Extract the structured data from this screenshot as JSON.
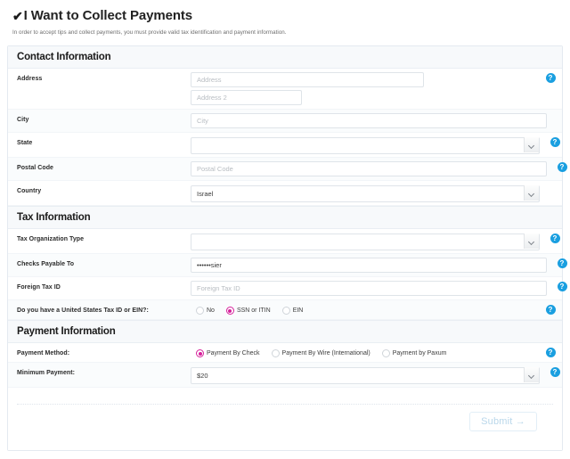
{
  "header": {
    "check_icon": "✔",
    "title": "I Want to Collect Payments",
    "subtitle": "In order to accept tips and collect payments, you must provide valid tax identification and payment information."
  },
  "help_icon_glyph": "?",
  "sections": {
    "contact": {
      "heading": "Contact Information",
      "address": {
        "label": "Address",
        "line1_placeholder": "Address",
        "line1_value": "",
        "line2_placeholder": "Address 2",
        "line2_value": ""
      },
      "city": {
        "label": "City",
        "placeholder": "City",
        "value": ""
      },
      "state": {
        "label": "State",
        "value": ""
      },
      "postal_code": {
        "label": "Postal Code",
        "placeholder": "Postal Code",
        "value": ""
      },
      "country": {
        "label": "Country",
        "value": "Israel"
      }
    },
    "tax": {
      "heading": "Tax Information",
      "org_type": {
        "label": "Tax Organization Type",
        "value": ""
      },
      "checks_payable_to": {
        "label": "Checks Payable To",
        "value": "••••••sier"
      },
      "foreign_tax_id": {
        "label": "Foreign Tax ID",
        "placeholder": "Foreign Tax ID",
        "value": ""
      },
      "us_tax_id": {
        "label": "Do you have a United States Tax ID or EIN?:",
        "options": [
          {
            "label": "No",
            "selected": false
          },
          {
            "label": "SSN or ITIN",
            "selected": true
          },
          {
            "label": "EIN",
            "selected": false
          }
        ]
      }
    },
    "payment": {
      "heading": "Payment Information",
      "payment_method": {
        "label": "Payment Method:",
        "options": [
          {
            "label": "Payment By Check",
            "selected": true
          },
          {
            "label": "Payment By Wire (International)",
            "selected": false
          },
          {
            "label": "Payment by Paxum",
            "selected": false
          }
        ]
      },
      "minimum_payment": {
        "label": "Minimum Payment:",
        "value": "$20"
      }
    }
  },
  "footer": {
    "submit_label": "Submit →"
  },
  "colors": {
    "accent_pink": "#d6219b",
    "help_blue": "#1a9fe0",
    "submit_text": "#b9d7ea"
  }
}
